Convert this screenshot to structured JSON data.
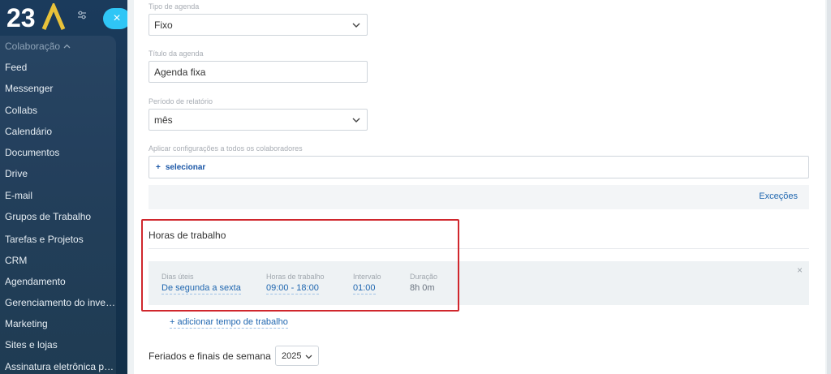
{
  "sidebar": {
    "logo_text": "23A",
    "section_label": "Colaboração",
    "items": [
      {
        "label": "Feed"
      },
      {
        "label": "Messenger"
      },
      {
        "label": "Collabs"
      },
      {
        "label": "Calendário"
      },
      {
        "label": "Documentos"
      },
      {
        "label": "Drive"
      },
      {
        "label": "E-mail"
      },
      {
        "label": "Grupos de Trabalho"
      },
      {
        "label": "Tarefas e Projetos"
      },
      {
        "label": "CRM"
      },
      {
        "label": "Agendamento"
      },
      {
        "label": "Gerenciamento do invent..."
      },
      {
        "label": "Marketing"
      },
      {
        "label": "Sites e lojas"
      },
      {
        "label": "Assinatura eletrônica para..."
      }
    ],
    "close_glyph": "×"
  },
  "form": {
    "schedule_type": {
      "label": "Tipo de agenda",
      "value": "Fixo"
    },
    "schedule_title": {
      "label": "Título da agenda",
      "value": "Agenda fixa"
    },
    "report_period": {
      "label": "Período de relatório",
      "value": "mês"
    },
    "apply_all": {
      "label": "Aplicar configurações a todos os colaboradores",
      "button": "selecionar",
      "plus": "+"
    },
    "exceptions_link": "Exceções"
  },
  "working_hours": {
    "title": "Horas de trabalho",
    "columns": {
      "days": {
        "label": "Dias úteis",
        "value": "De segunda a sexta"
      },
      "hours": {
        "label": "Horas de trabalho",
        "value": "09:00 - 18:00"
      },
      "break": {
        "label": "Intervalo",
        "value": "01:00"
      },
      "duration": {
        "label": "Duração",
        "value": "8h 0m"
      }
    },
    "close_glyph": "×",
    "add_link": "+ adicionar tempo de trabalho"
  },
  "holidays": {
    "title": "Feriados e finais de semana",
    "year": "2025"
  },
  "colors": {
    "sidebar_bg": "#1b3b5c",
    "accent_cyan": "#2fc6f6",
    "link_blue": "#2067b0",
    "highlight_red": "#d0272d"
  }
}
